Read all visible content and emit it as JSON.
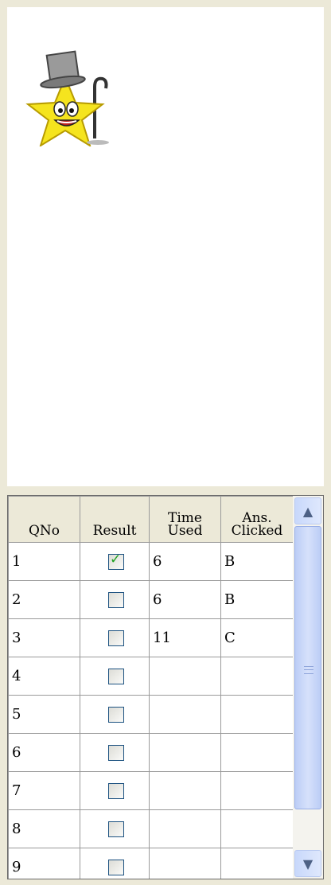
{
  "mascot": {
    "icon": "star-top-hat-cane-icon"
  },
  "grid": {
    "headers": {
      "qno": "QNo",
      "result": "Result",
      "time_line1": "Time",
      "time_line2": "Used",
      "ans_line1": "Ans.",
      "ans_line2": "Clicked"
    },
    "rows": [
      {
        "qno": "1",
        "checked": true,
        "time": "6",
        "ans": "B"
      },
      {
        "qno": "2",
        "checked": false,
        "time": "6",
        "ans": "B"
      },
      {
        "qno": "3",
        "checked": false,
        "time": "11",
        "ans": "C"
      },
      {
        "qno": "4",
        "checked": false,
        "time": "",
        "ans": ""
      },
      {
        "qno": "5",
        "checked": false,
        "time": "",
        "ans": ""
      },
      {
        "qno": "6",
        "checked": false,
        "time": "",
        "ans": ""
      },
      {
        "qno": "7",
        "checked": false,
        "time": "",
        "ans": ""
      },
      {
        "qno": "8",
        "checked": false,
        "time": "",
        "ans": ""
      },
      {
        "qno": "9",
        "checked": false,
        "time": "",
        "ans": ""
      }
    ]
  },
  "scrollbar": {
    "up_icon": "chevron-up-icon",
    "down_icon": "chevron-down-icon",
    "grip_icon": "scroll-grip-icon"
  }
}
